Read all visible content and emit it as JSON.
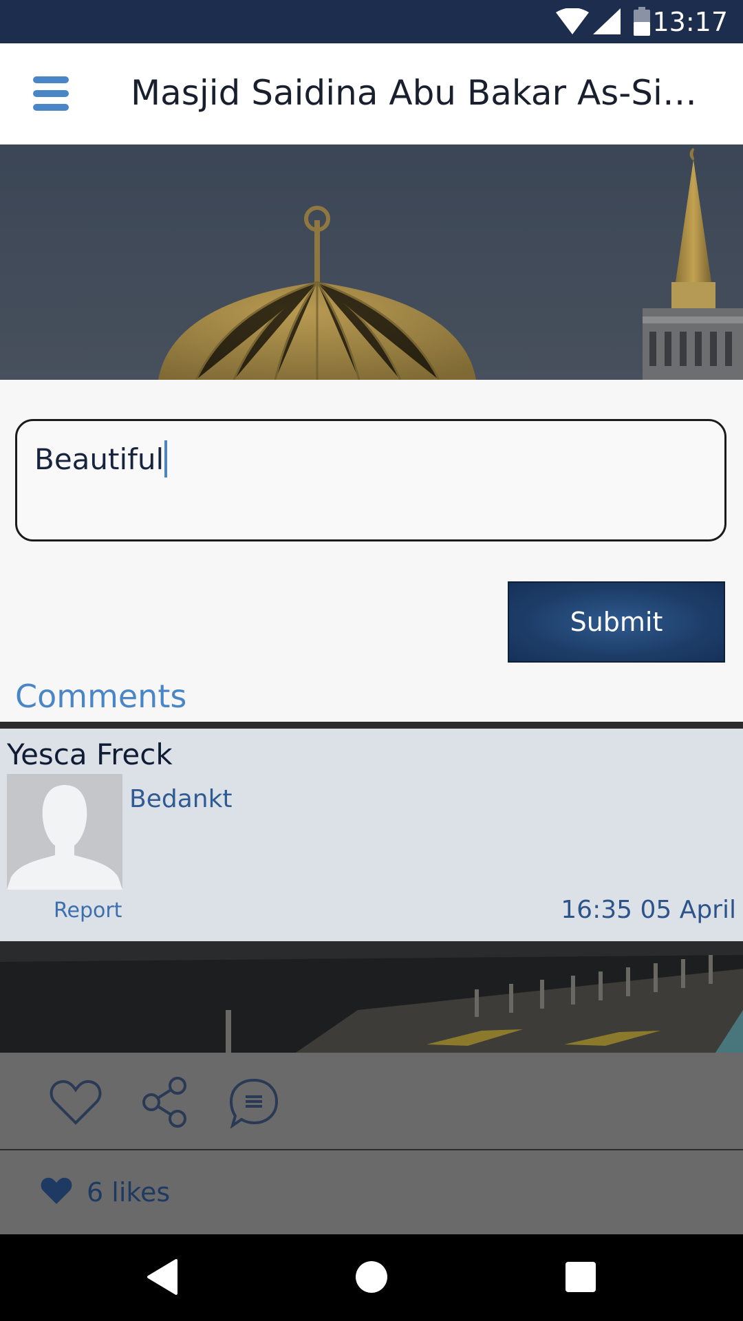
{
  "status_bar": {
    "time": "13:17"
  },
  "app_bar": {
    "title": "Masjid Saidina Abu Bakar As-Siddi..."
  },
  "comment_form": {
    "input_value": "Beautiful",
    "submit_label": "Submit",
    "comments_heading": "Comments"
  },
  "comments": [
    {
      "author": "Yesca Freck",
      "text": "Bedankt",
      "report_label": "Report",
      "time": "16:35 05 April"
    }
  ],
  "post_actions": {
    "likes_label": "6 likes"
  },
  "colors": {
    "accent": "#4a86c6",
    "status_bar": "#1c2d4e",
    "submit_button": "#1d3d68",
    "comment_card": "#dce0e7"
  },
  "icons": [
    "menu-icon",
    "wifi-icon",
    "signal-icon",
    "battery-icon",
    "heart-outline-icon",
    "share-icon",
    "comment-icon",
    "heart-filled-icon",
    "back-icon",
    "home-icon",
    "recents-icon"
  ]
}
